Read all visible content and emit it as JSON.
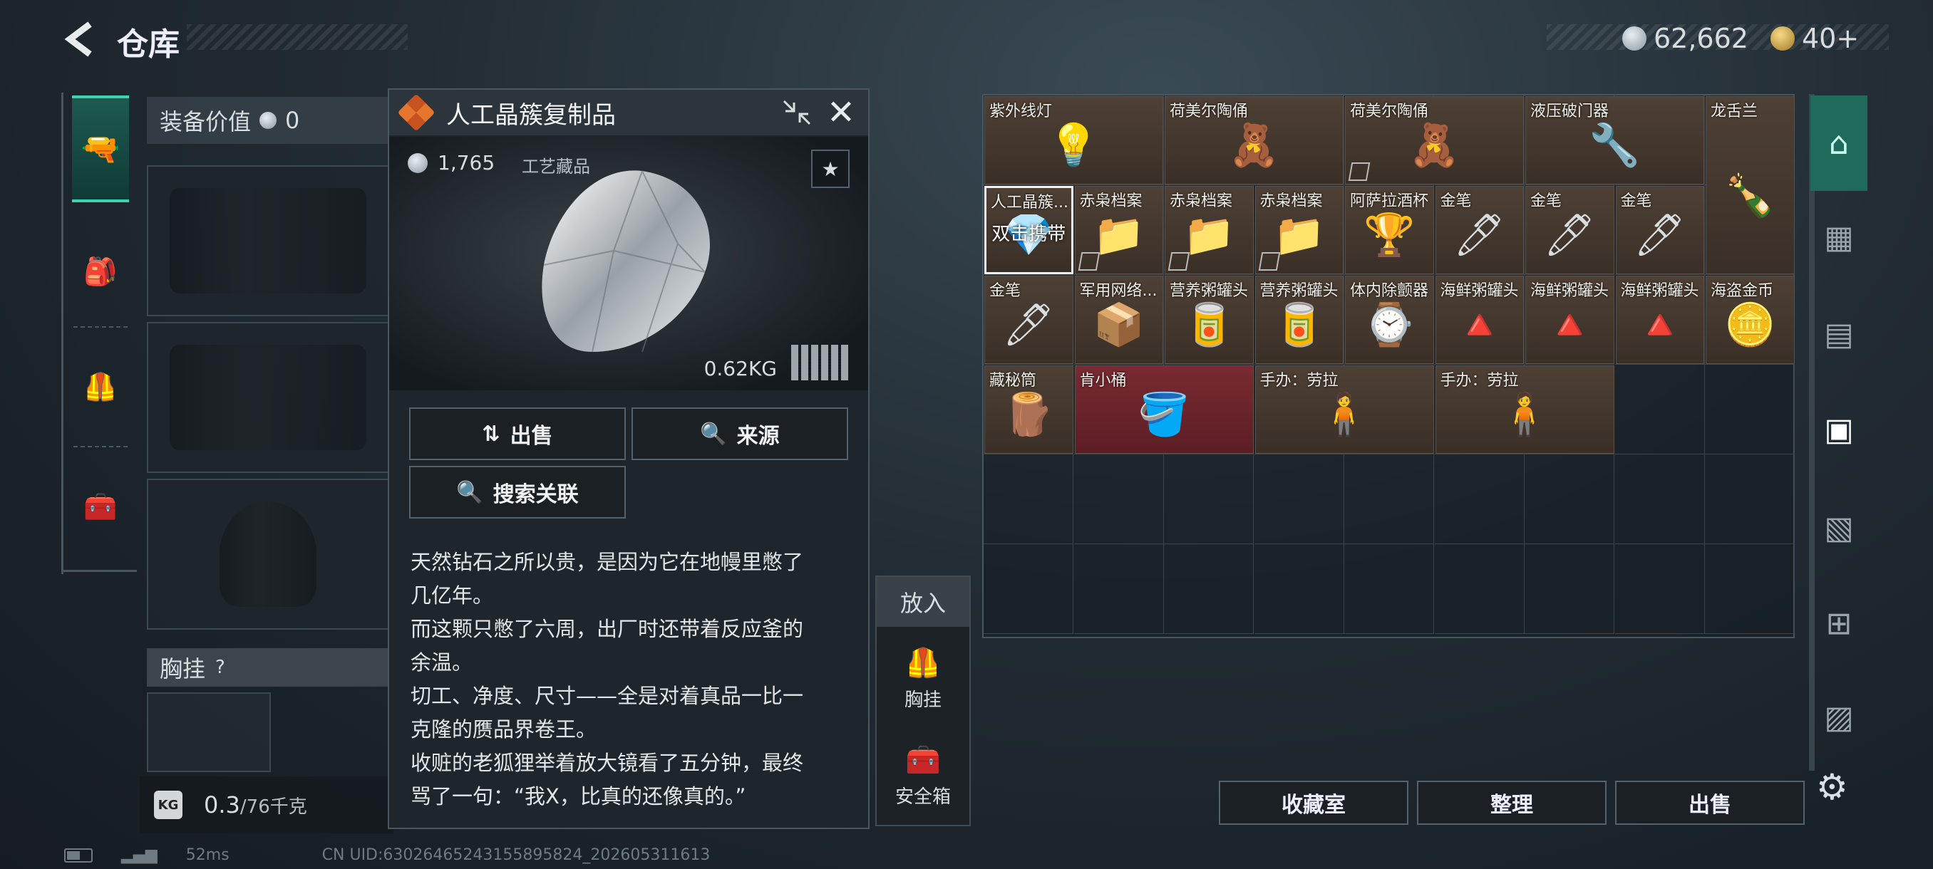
{
  "header": {
    "title": "仓库",
    "silver": "62,662",
    "gold": "40+"
  },
  "left_nav": {
    "items": [
      "pistol-icon",
      "backpack-icon",
      "vest-icon",
      "toolbox-icon"
    ]
  },
  "equipment": {
    "value_label": "装备价值",
    "value": "0",
    "vest_label": "胸挂",
    "help": "?",
    "weight_value": "0.3",
    "weight_total": "/76千克"
  },
  "item_detail": {
    "title": "人工晶簇复制品",
    "price": "1,765",
    "category": "工艺藏品",
    "weight": "0.62KG",
    "buttons": {
      "sell": "出售",
      "source": "来源",
      "search_related": "搜索关联"
    },
    "description": [
      "天然钻石之所以贵，是因为它在地幔里憋了",
      "几亿年。",
      "而这颗只憋了六周，出厂时还带着反应釜的",
      "余温。",
      "切工、净度、尺寸——全是对着真品一比一",
      "克隆的赝品界卷王。",
      "收赃的老狐狸举着放大镜看了五分钟，最终",
      "骂了一句：“我X，比真的还像真的。”"
    ]
  },
  "put_in": {
    "title": "放入",
    "vest": "胸挂",
    "safe": "安全箱"
  },
  "inventory": {
    "items": [
      {
        "label": "紫外线灯",
        "icon": "uv-lamp-icon",
        "art": "💡"
      },
      {
        "label": "荷美尔陶俑",
        "icon": "figurine-icon",
        "art": "🧸"
      },
      {
        "label": "荷美尔陶俑",
        "icon": "figurine-icon",
        "art": "🧸"
      },
      {
        "label": "液压破门器",
        "icon": "breacher-icon",
        "art": "🔧"
      },
      {
        "label": "龙舌兰",
        "icon": "tequila-icon",
        "art": "🍾"
      },
      {
        "label": "人工晶簇...",
        "icon": "crystal-icon",
        "art": "💎",
        "overlay": "双击携带"
      },
      {
        "label": "赤枭档案",
        "icon": "file-icon",
        "art": "📁"
      },
      {
        "label": "赤枭档案",
        "icon": "file-icon",
        "art": "📁"
      },
      {
        "label": "赤枭档案",
        "icon": "file-icon",
        "art": "📁"
      },
      {
        "label": "阿萨拉酒杯",
        "icon": "cup-icon",
        "art": "🏆"
      },
      {
        "label": "金笔",
        "icon": "pen-icon",
        "art": "🖊"
      },
      {
        "label": "金笔",
        "icon": "pen-icon",
        "art": "🖊"
      },
      {
        "label": "金笔",
        "icon": "pen-icon",
        "art": "🖊"
      },
      {
        "label": "金笔",
        "icon": "pen-icon",
        "art": "🖊"
      },
      {
        "label": "军用网络...",
        "icon": "network-module-icon",
        "art": "📦"
      },
      {
        "label": "营养粥罐头",
        "icon": "can-icon",
        "art": "🥫"
      },
      {
        "label": "营养粥罐头",
        "icon": "can-icon",
        "art": "🥫"
      },
      {
        "label": "体内除颤器",
        "icon": "defib-icon",
        "art": "⌚"
      },
      {
        "label": "海鲜粥罐头",
        "icon": "seafood-can-icon",
        "art": "🔺"
      },
      {
        "label": "海鲜粥罐头",
        "icon": "seafood-can-icon",
        "art": "🔺"
      },
      {
        "label": "海鲜粥罐头",
        "icon": "seafood-can-icon",
        "art": "🔺"
      },
      {
        "label": "海盗金币",
        "icon": "coin-icon",
        "art": "🪙"
      },
      {
        "label": "藏秘筒",
        "icon": "cryptex-icon",
        "art": "🪵"
      },
      {
        "label": "肯小桶",
        "icon": "bucket-icon",
        "art": "🪣"
      },
      {
        "label": "手办：劳拉",
        "icon": "figure-laura-icon",
        "art": "🧍"
      },
      {
        "label": "手办：劳拉",
        "icon": "figure-laura-icon",
        "art": "🧍"
      }
    ]
  },
  "bottom_buttons": {
    "collection": "收藏室",
    "sort": "整理",
    "sell": "出售"
  },
  "footer": {
    "ping": "52ms",
    "uid": "CN UID:63026465243155895824_202605311613"
  },
  "colors": {
    "accent": "#1f6a5b",
    "item_bg": "#4e4035",
    "item_red": "#7a2a32"
  }
}
